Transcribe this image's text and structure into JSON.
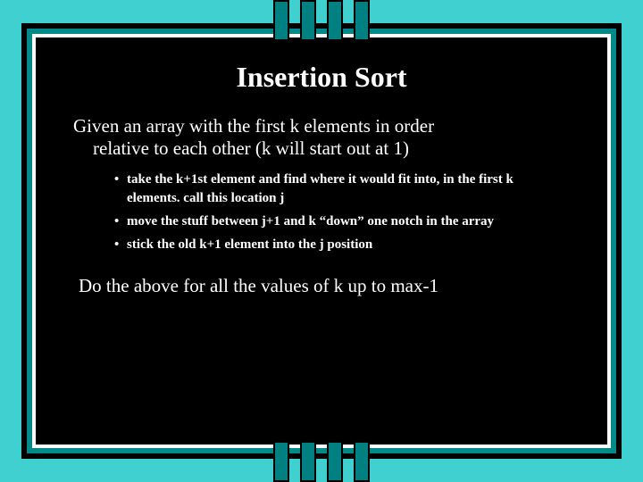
{
  "slide": {
    "title": "Insertion Sort",
    "intro_line1": "Given an array with the first k elements in order",
    "intro_line2": "relative to each other (k will start out at 1)",
    "bullets": [
      "take the k+1st element and find where it would fit into, in the first k elements. call this location j",
      "move the stuff between j+1 and k “down” one notch in the array",
      "stick the old k+1 element into the j position"
    ],
    "closing": "Do the above for all the values of k up to max-1"
  }
}
